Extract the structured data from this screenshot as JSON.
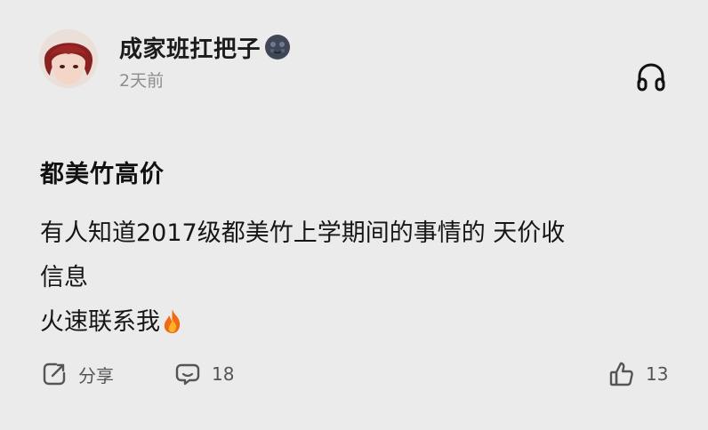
{
  "header": {
    "username": "成家班扛把子",
    "timestamp": "2天前"
  },
  "post": {
    "title": "都美竹高价",
    "body_lines": [
      "有人知道2017级都美竹上学期间的事情的 天价收",
      "信息",
      "火速联系我"
    ]
  },
  "actions": {
    "share_label": "分享",
    "comment_count": "18",
    "like_count": "13"
  },
  "icons": {
    "level_badge": "dark-round-face-badge-icon",
    "listen": "headphones-icon",
    "fire": "fire-icon",
    "share": "share-edit-icon",
    "comment": "comment-bubble-icon",
    "like": "thumbs-up-icon"
  },
  "colors": {
    "background": "#ebebeb",
    "text_primary": "#111111",
    "text_secondary": "#8e8e8e",
    "action_text": "#555555"
  }
}
